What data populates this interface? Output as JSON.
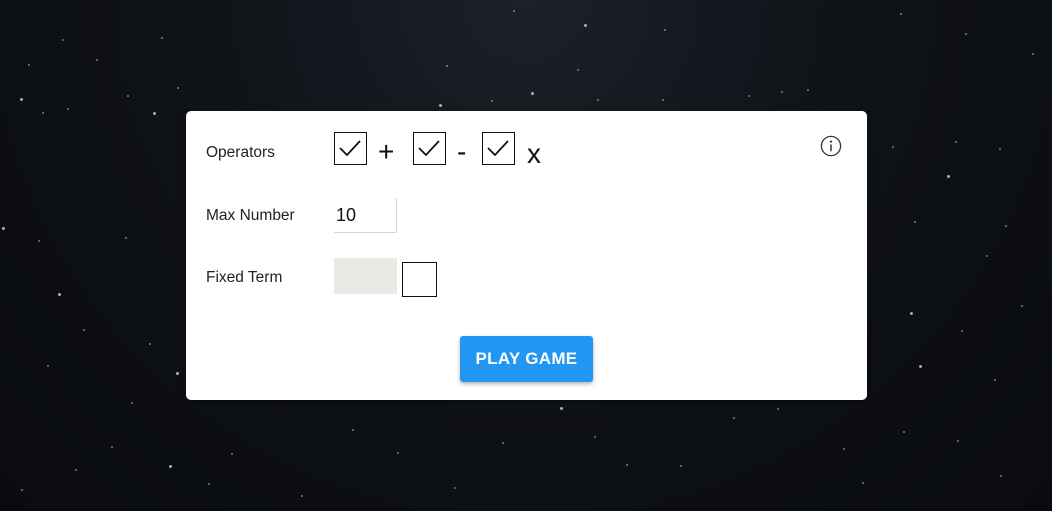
{
  "settings": {
    "operators": {
      "label": "Operators",
      "items": [
        {
          "symbol": "+",
          "checked": true
        },
        {
          "symbol": "-",
          "checked": true
        },
        {
          "symbol": "x",
          "checked": true
        }
      ]
    },
    "max_number": {
      "label": "Max Number",
      "value": "10"
    },
    "fixed_term": {
      "label": "Fixed Term",
      "value": "",
      "checked": false
    }
  },
  "actions": {
    "play_label": "PLAY GAME"
  },
  "icons": {
    "info": "info-icon",
    "check": "checkmark-icon"
  },
  "colors": {
    "accent": "#2196f3",
    "card": "#ffffff",
    "background": "#0f1217"
  }
}
